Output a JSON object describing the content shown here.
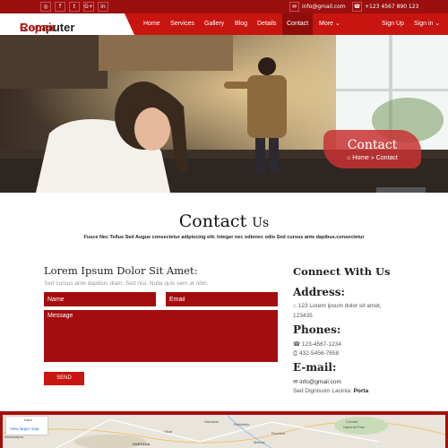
{
  "topbar": {
    "social_icons": [
      {
        "name": "rss-icon",
        "glyph": "◎"
      },
      {
        "name": "facebook-icon",
        "glyph": "f"
      },
      {
        "name": "twitter-icon",
        "glyph": "t"
      },
      {
        "name": "google-plus-icon",
        "glyph": "G+"
      },
      {
        "name": "linkedin-icon",
        "glyph": "in"
      }
    ],
    "email": "info@gmail.com",
    "phone": "+123 4567 890 123"
  },
  "nav": {
    "brand_part1": "Computer",
    "brand_part2": "Repair",
    "items": [
      "Home",
      "Services",
      "Gallery",
      "Blog",
      "Details",
      "Contact",
      "More ⌄"
    ],
    "active": "Contact",
    "signup": "Sign Up",
    "signin": "Sign in ⌄"
  },
  "hero": {
    "badge_title": "Contact",
    "breadcrumb": "⌂ Home » Contact"
  },
  "section": {
    "title_main": "Contact",
    "title_suffix": "Us",
    "subtitle": "Fusce Nec Tellus Sed Augue consectetur adipiscing elit. Integer nec odionec odio Sed cursus ante dapibus.consectetur"
  },
  "form": {
    "heading": "Lorem Ipsum Dolor Sit Amet:",
    "subheading": "Sed cursus ante dapibus diam. Sed nisi. Nulla quis sem at nibh.",
    "name_placeholder": "Name",
    "email_placeholder": "Email",
    "message_placeholder": "Message",
    "send_label": "SEND"
  },
  "connect": {
    "heading": "Connect With Us",
    "address_label": "Address:",
    "address_line1": "⌂ 123 Lorem ipsum dolor sit amet,",
    "address_line2": "123435",
    "phones_label": "Phones:",
    "phone1": "☎ 123-4567-1234",
    "phone2": "⎙ 432-5456-7658",
    "email_label": "E-mail:",
    "email": "✉ info@gmail.com",
    "tagline_prefix": "Sed Dignissim Lacinia:",
    "tagline_bold": "Porta"
  },
  "map": {
    "view_larger": "View larger map",
    "place_labels": [
      "Nara",
      "Bahawalpur",
      "Haridwar",
      "Rishikesh",
      "Corbett",
      "National Park",
      "HARYANA",
      "Hisar",
      "Meerut",
      "Roorkee"
    ]
  },
  "colors": {
    "accent": "#c8150f",
    "accent_dark": "#9b0f0f",
    "field_bg": "#a40d0d"
  }
}
